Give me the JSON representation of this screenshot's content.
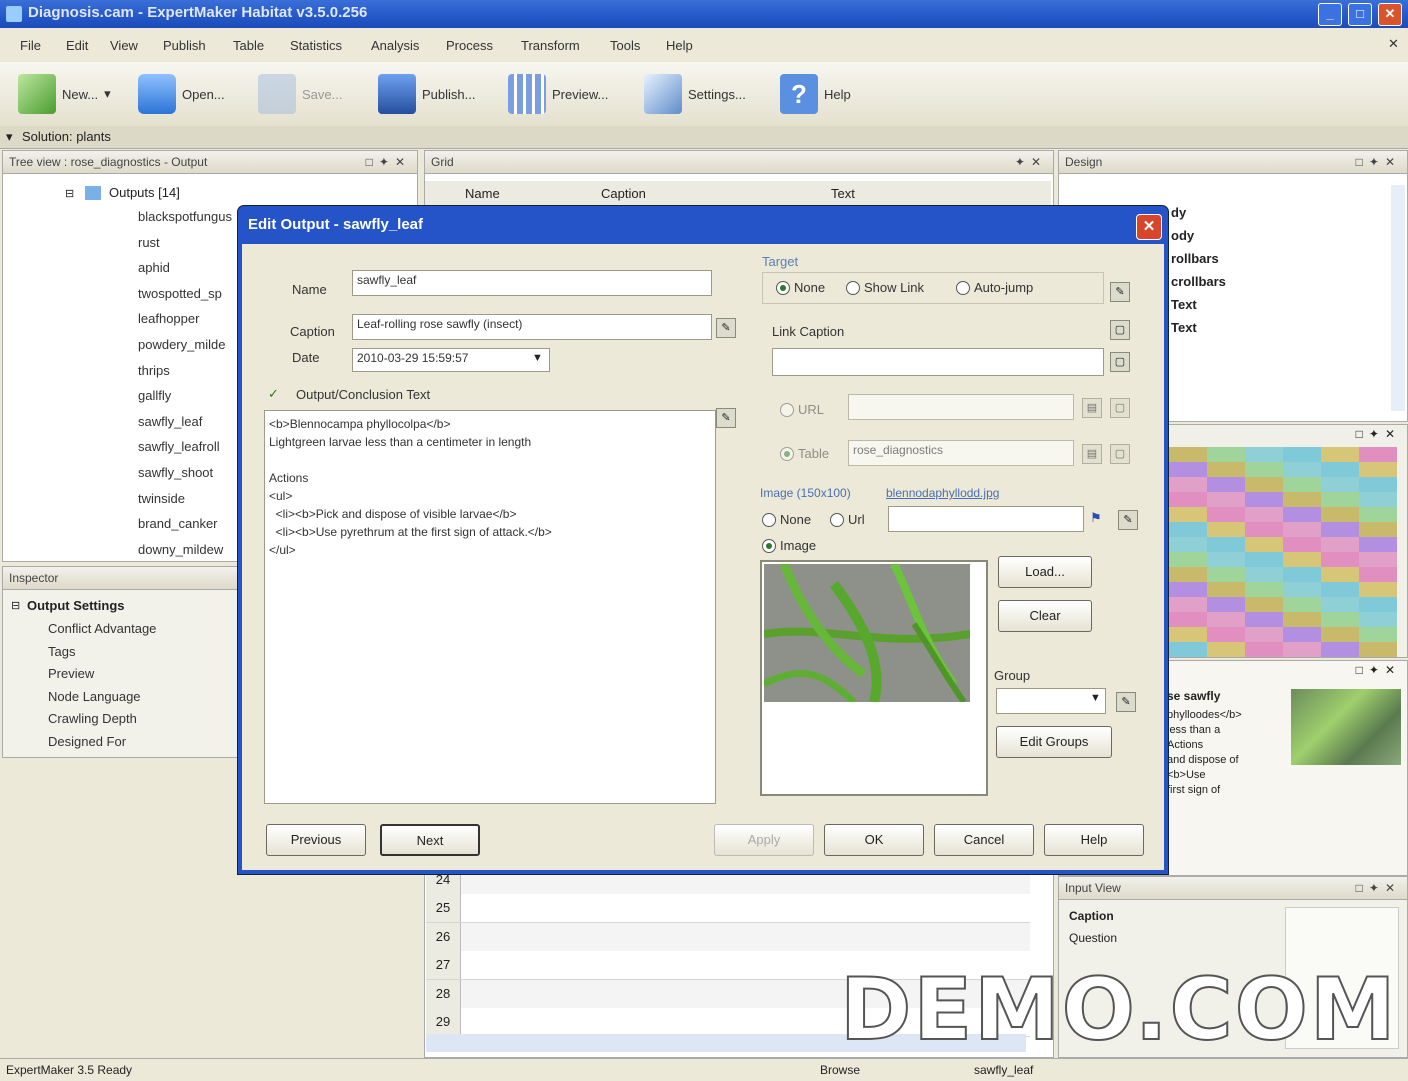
{
  "app": {
    "title": "Diagnosis.cam - ExpertMaker Habitat v3.5.0.256",
    "minimize": "_",
    "maximize": "□",
    "close": "✕"
  },
  "menu": [
    "File",
    "Edit",
    "View",
    "Publish",
    "Table",
    "Statistics",
    "Analysis",
    "Process",
    "Transform",
    "Tools",
    "Help"
  ],
  "toolbar": {
    "new_label": "New...",
    "open_label": "Open...",
    "save_label": "Save...",
    "publish_label": "Publish...",
    "preview_label": "Preview...",
    "settings_label": "Settings...",
    "help_label": "Help"
  },
  "solution": {
    "label": "Solution: plants"
  },
  "tree": {
    "header": "Tree view : rose_diagnostics - Output",
    "root": "Outputs [14]",
    "items": [
      "blackspotfungus",
      "rust",
      "aphid",
      "twospotted_sp",
      "leafhopper",
      "powdery_milde",
      "thrips",
      "gallfly",
      "sawfly_leaf",
      "sawfly_leafroll",
      "sawfly_shoot",
      "twinside",
      "brand_canker",
      "downy_mildew"
    ]
  },
  "inspector": {
    "header": "Inspector",
    "section": "Output Settings",
    "rows": [
      "Conflict Advantage",
      "Tags",
      "Preview",
      "Node Language",
      "Crawling Depth",
      "Designed For"
    ]
  },
  "grid": {
    "header": "Grid",
    "columns": [
      "Name",
      "Caption",
      "Text"
    ],
    "rows": [
      "24",
      "25",
      "26",
      "27",
      "28",
      "29"
    ]
  },
  "design": {
    "header": "Design",
    "items": [
      "dy",
      "ody",
      "rollbars",
      "crollbars",
      "Text",
      "Text"
    ]
  },
  "input_view": {
    "header": "Input View",
    "caption": "Caption",
    "question": "Question"
  },
  "preview_snip": {
    "title": "se sawfly",
    "lines": [
      "phylloodes</b>",
      "less than a",
      "Actions",
      "and dispose of",
      "<b>Use",
      "first sign of"
    ]
  },
  "dialog": {
    "title": "Edit Output - sawfly_leaf",
    "name_label": "Name",
    "name_value": "sawfly_leaf",
    "caption_label": "Caption",
    "caption_value": "Leaf-rolling rose sawfly (insect)",
    "date_label": "Date",
    "date_value": "2010-03-29 15:59:57",
    "text_section": "Output/Conclusion Text",
    "text_lines": [
      "<b>Blennocampa phyllocolpa</b>",
      "Lightgreen larvae less than a centimeter in length",
      "",
      "Actions",
      "<ul>",
      "  <li><b>Pick and dispose of visible larvae</b>",
      "  <li><b>Use pyrethrum at the first sign of attack.</b>",
      "</ul>"
    ],
    "target_label": "Target",
    "target_none": "None",
    "target_show_link": "Show Link",
    "target_autojump": "Auto-jump",
    "link_caption_label": "Link Caption",
    "link_caption_value": "",
    "url_label": "URL",
    "url_value": "",
    "table_label": "Table",
    "table_value": "rose_diagnostics",
    "image_label": "Image (150x100)",
    "image_file": "blennodaphyllodd.jpg",
    "img_none": "None",
    "img_url": "Url",
    "img_image": "Image",
    "img_url_value": "",
    "load_button": "Load...",
    "clear_button": "Clear",
    "group_label": "Group",
    "group_value": "",
    "edit_groups_button": "Edit Groups",
    "previous_button": "Previous",
    "next_button": "Next",
    "apply_button": "Apply",
    "ok_button": "OK",
    "cancel_button": "Cancel",
    "help_button": "Help"
  },
  "status": {
    "left": "ExpertMaker 3.5 Ready",
    "mid": "Browse",
    "right": "sawfly_leaf"
  },
  "watermark": "DEMO.COM"
}
